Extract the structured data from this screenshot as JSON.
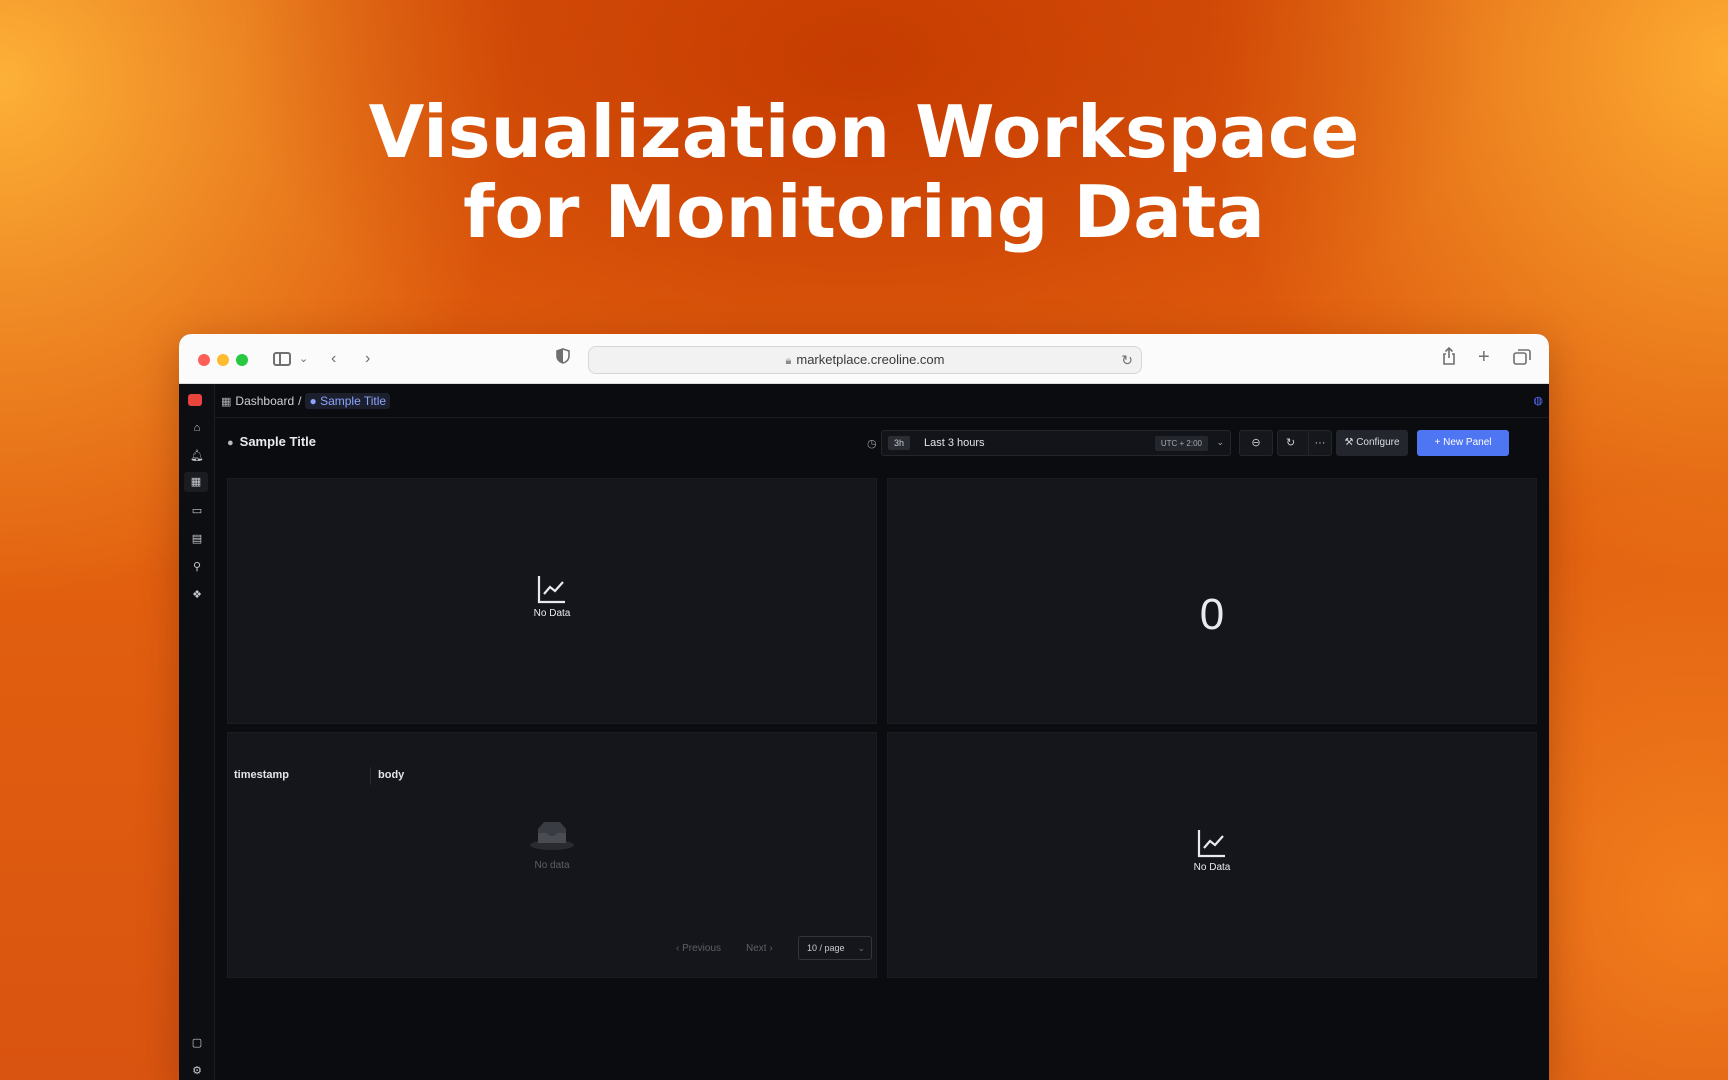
{
  "headline": {
    "line1": "Visualization Workspace",
    "line2": "for Monitoring Data"
  },
  "browser": {
    "url": "marketplace.creoline.com"
  },
  "icons": {
    "lock": "lock-icon",
    "reload": "reload-icon",
    "share": "share-icon",
    "new_tab": "plus-icon",
    "tabs": "tab-overview-icon"
  },
  "breadcrumb": {
    "root": "Dashboard",
    "separator": "/",
    "current": "Sample Title"
  },
  "dashboard": {
    "title": "Sample Title",
    "time_badge": "3h",
    "time_label": "Last 3 hours",
    "timezone": "UTC + 2:00",
    "more_label": "···",
    "configure_label": "Configure",
    "new_panel_label": "New Panel"
  },
  "panels": {
    "p1": {
      "nodata": "No Data"
    },
    "p2": {
      "value": "0"
    },
    "p3": {
      "columns": [
        "timestamp",
        "body"
      ],
      "empty": "No data",
      "prev": "Previous",
      "next": "Next",
      "page_size": "10 / page"
    },
    "p4": {
      "nodata": "No Data"
    }
  },
  "colors": {
    "accent": "#4e75f2",
    "breadcrumb_current": "#8ea3ff",
    "logo": "#e8453c"
  }
}
